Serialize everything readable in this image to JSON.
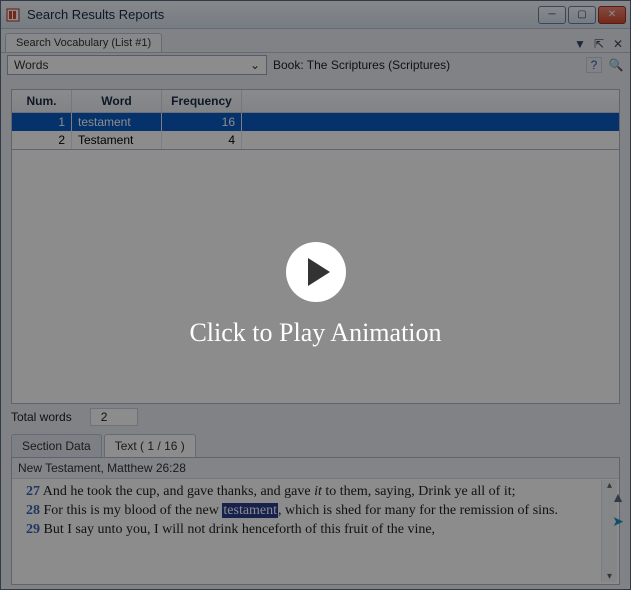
{
  "window": {
    "title": "Search Results Reports"
  },
  "tabs": {
    "main": "Search Vocabulary (List #1)"
  },
  "toolbar": {
    "dropdown": {
      "label": "Words",
      "caret": "⌄"
    },
    "book": "Book: The Scriptures (Scriptures)"
  },
  "table": {
    "headers": {
      "num": "Num.",
      "word": "Word",
      "freq": "Frequency"
    },
    "rows": [
      {
        "num": "1",
        "word": "testament",
        "freq": "16",
        "selected": true
      },
      {
        "num": "2",
        "word": "Testament",
        "freq": "4",
        "selected": false
      }
    ]
  },
  "total": {
    "label": "Total words",
    "value": "2"
  },
  "bottomTabs": {
    "section": "Section Data",
    "text": "Text ( 1 / 16 )"
  },
  "preview": {
    "header": "New Testament, Matthew 26:28",
    "v27a": "27",
    "v27b": " And he took the cup, and gave thanks, and gave ",
    "v27it": "it",
    "v27c": " to them, saying, Drink ye all of it;",
    "v28a": "28",
    "v28b": " For this is my blood of the new ",
    "v28hl": "testament",
    "v28c": ", which is shed for many for the remission of sins.",
    "v29a": "29",
    "v29b": " But I say unto you, I will not drink henceforth of this fruit of the vine,"
  },
  "overlay": {
    "text": "Click to Play Animation"
  }
}
